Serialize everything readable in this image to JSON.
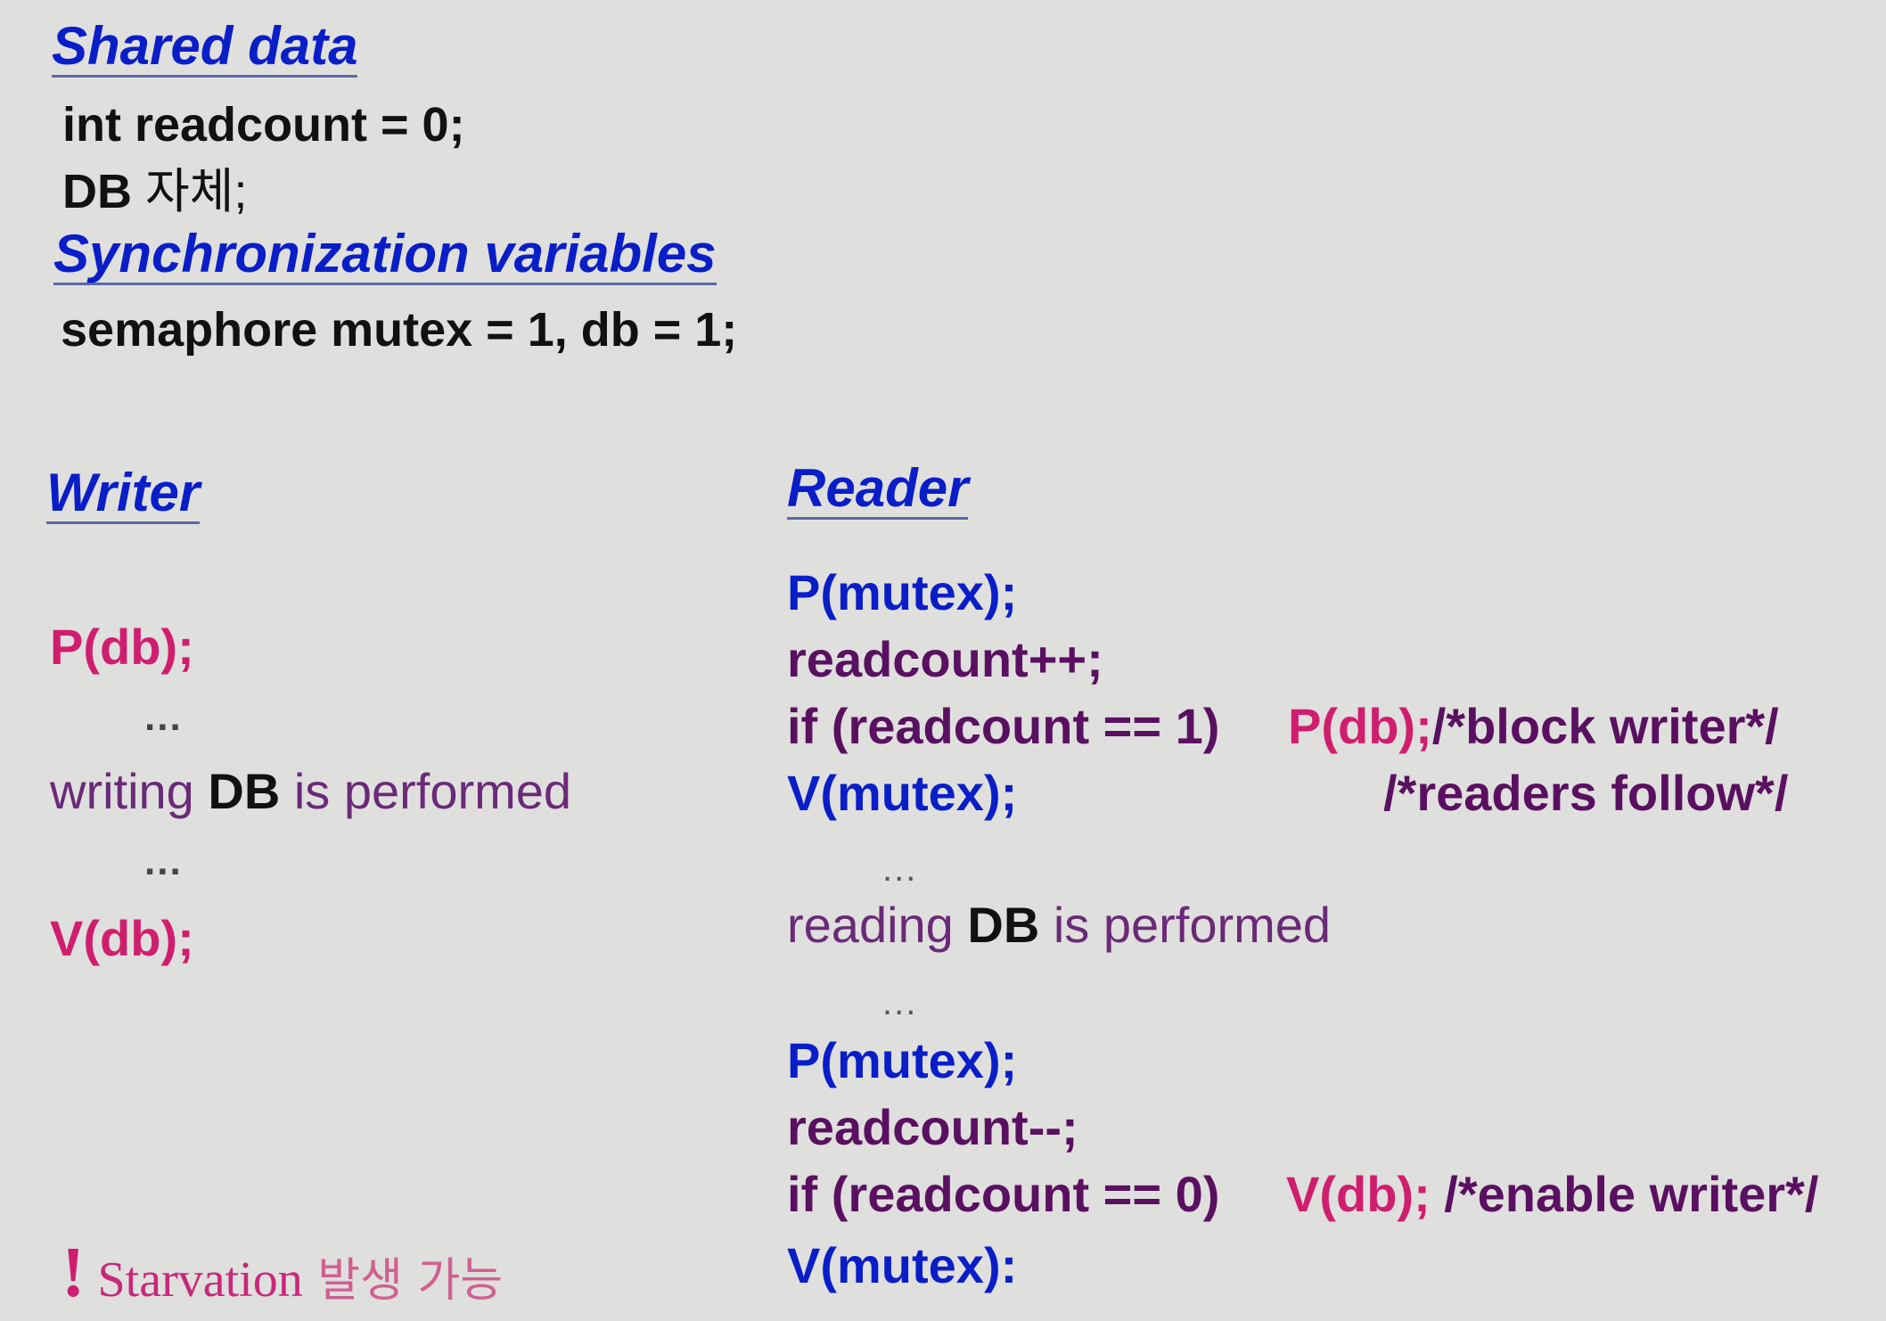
{
  "shared_data": {
    "heading": "Shared data",
    "lines": [
      "int readcount = 0;",
      "DB",
      " 자체;"
    ]
  },
  "sync_vars": {
    "heading": "Synchronization variables",
    "line": "semaphore mutex = 1, db = 1;"
  },
  "writer": {
    "heading": "Writer",
    "p_db": "P(db);",
    "dots1": "...",
    "writing_pre": "writing ",
    "writing_db": "DB",
    "writing_post": " is performed",
    "dots2": "...",
    "v_db": "V(db);"
  },
  "reader": {
    "heading": "Reader",
    "p_mutex_1": "P(mutex);",
    "inc": "readcount++;",
    "if1_cond": "if (readcount == 1)",
    "if1_action": "P(db);",
    "if1_comment": "/*block writer*/",
    "v_mutex_1": "V(mutex);",
    "comment2": "/*readers follow*/",
    "dots1": "...",
    "reading_pre": "reading ",
    "reading_db": "DB",
    "reading_post": " is performed",
    "dots2": "...",
    "p_mutex_2": "P(mutex);",
    "dec": "readcount--;",
    "if2_cond": "if (readcount == 0)",
    "if2_action": "V(db);",
    "if2_comment": " /*enable writer*/",
    "v_mutex_2": "V(mutex):"
  },
  "note": {
    "icon": "exclamation-icon",
    "symbol": "!",
    "text": "Starvation",
    "korean": " 발생 가능"
  },
  "colors": {
    "heading_blue": "#0a1ec8",
    "code_purple": "#5a1060",
    "db_pink": "#d01e6e",
    "background": "#dfdfdd"
  }
}
